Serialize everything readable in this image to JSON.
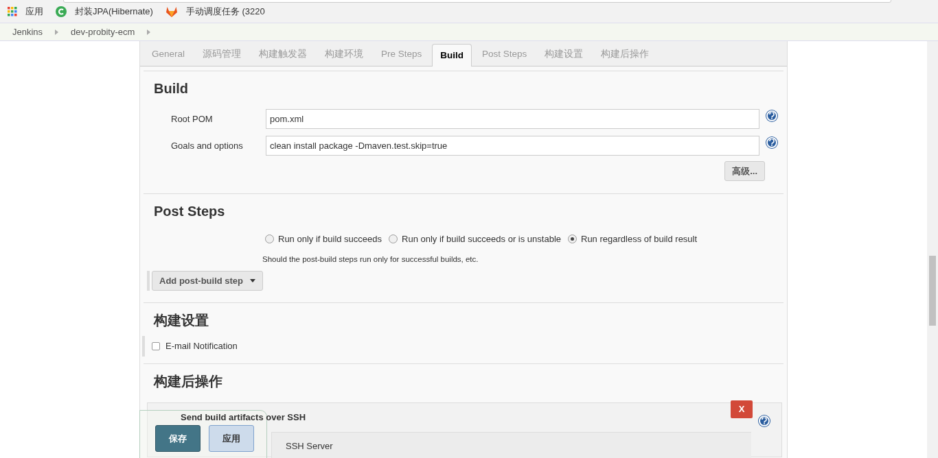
{
  "bookmarks": [
    {
      "label": "应用",
      "kind": "apps"
    },
    {
      "label": "封装JPA(Hibernate)",
      "kind": "c"
    },
    {
      "label": "手动调度任务 (3220",
      "kind": "fox"
    }
  ],
  "breadcrumbs": [
    "Jenkins",
    "dev-probity-ecm"
  ],
  "tabs": [
    {
      "label": "General",
      "selected": false
    },
    {
      "label": "源码管理",
      "selected": false
    },
    {
      "label": "构建触发器",
      "selected": false
    },
    {
      "label": "构建环境",
      "selected": false
    },
    {
      "label": "Pre Steps",
      "selected": false
    },
    {
      "label": "Build",
      "selected": true
    },
    {
      "label": "Post Steps",
      "selected": false
    },
    {
      "label": "构建设置",
      "selected": false
    },
    {
      "label": "构建后操作",
      "selected": false
    }
  ],
  "build": {
    "title": "Build",
    "fields": [
      {
        "label": "Root POM",
        "value": "pom.xml"
      },
      {
        "label": "Goals and options",
        "value": "clean install package -Dmaven.test.skip=true"
      }
    ],
    "advanced_button": "高级..."
  },
  "post_steps": {
    "title": "Post Steps",
    "options": [
      {
        "label": "Run only if build succeeds",
        "selected": false
      },
      {
        "label": "Run only if build succeeds or is unstable",
        "selected": false
      },
      {
        "label": "Run regardless of build result",
        "selected": true
      }
    ],
    "hint": "Should the post-build steps run only for successful builds, etc.",
    "add_button": "Add post-build step"
  },
  "build_settings": {
    "title": "构建设置",
    "email": {
      "label": "E-mail Notification",
      "checked": false
    }
  },
  "post_build": {
    "title": "构建后操作",
    "step_title": "Send build artifacts over SSH",
    "delete_button": "X",
    "server_label": "SSH Server"
  },
  "save_bar": {
    "save": "保存",
    "apply": "应用"
  }
}
